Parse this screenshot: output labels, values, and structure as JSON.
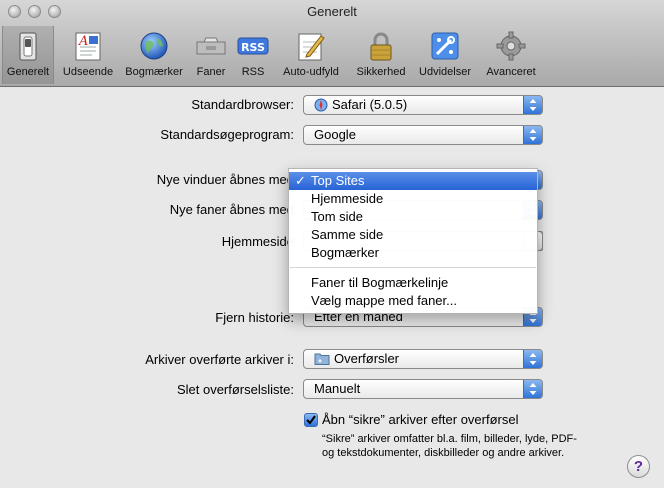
{
  "window": {
    "title": "Generelt"
  },
  "toolbar": {
    "items": [
      {
        "label": "Generelt",
        "icon": "switch-icon",
        "active": true
      },
      {
        "label": "Udseende",
        "icon": "font-icon"
      },
      {
        "label": "Bogmærker",
        "icon": "globe-icon"
      },
      {
        "label": "Faner",
        "icon": "tabs-icon"
      },
      {
        "label": "RSS",
        "icon": "rss-icon",
        "text": "RSS"
      },
      {
        "label": "Auto-udfyld",
        "icon": "pencil-form-icon"
      },
      {
        "label": "Sikkerhed",
        "icon": "lock-icon"
      },
      {
        "label": "Udvidelser",
        "icon": "extensions-icon"
      },
      {
        "label": "Avanceret",
        "icon": "gear-icon"
      }
    ]
  },
  "form": {
    "default_browser": {
      "label": "Standardbrowser:",
      "value": "Safari (5.0.5)"
    },
    "search_engine": {
      "label": "Standardsøgeprogram:",
      "value": "Google"
    },
    "new_windows": {
      "label": "Nye vinduer åbnes med"
    },
    "new_tabs": {
      "label": "Nye faner åbnes med"
    },
    "homepage": {
      "label": "Hjemmeside"
    },
    "remove_history": {
      "label": "Fjern historie:",
      "value": "Efter en måned"
    },
    "save_to": {
      "label": "Arkiver overførte arkiver i:",
      "value": "Overførsler"
    },
    "remove_downloads": {
      "label": "Slet overførselsliste:",
      "value": "Manuelt"
    },
    "open_safe": {
      "label": "Åbn “sikre” arkiver efter overførsel",
      "checked": true,
      "note": "“Sikre” arkiver omfatter bl.a. film, billeder, lyde, PDF- og tekstdokumenter, diskbilleder og andre arkiver."
    }
  },
  "menu": {
    "items": [
      {
        "label": "Top Sites",
        "selected": true
      },
      {
        "label": "Hjemmeside"
      },
      {
        "label": "Tom side"
      },
      {
        "label": "Samme side"
      },
      {
        "label": "Bogmærker"
      }
    ],
    "items2": [
      {
        "label": "Faner til Bogmærkelinje"
      },
      {
        "label": "Vælg mappe med faner..."
      }
    ]
  },
  "help": {
    "label": "?"
  },
  "colors": {
    "accent": "#2f73d8",
    "selection": "#3f78de"
  }
}
